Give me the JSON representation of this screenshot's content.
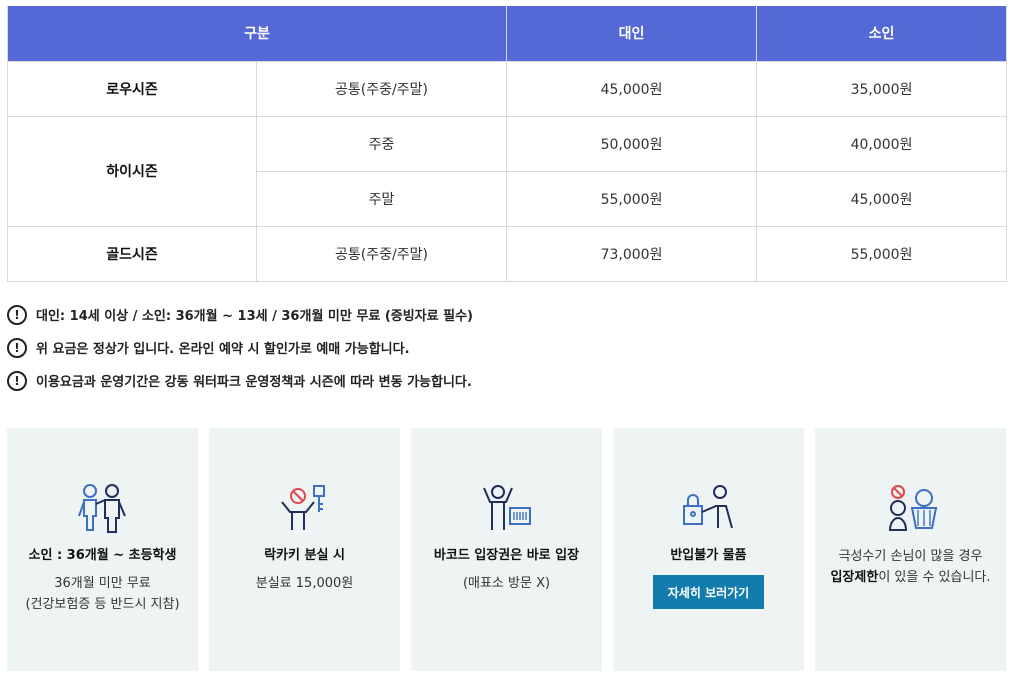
{
  "table": {
    "headers": {
      "category": "구분",
      "adult": "대인",
      "child": "소인"
    },
    "rows": [
      {
        "season": "로우시즌",
        "day": "공통(주중/주말)",
        "adult": "45,000원",
        "child": "35,000원"
      },
      {
        "season": "하이시즌",
        "day": "주중",
        "adult": "50,000원",
        "child": "40,000원"
      },
      {
        "day": "주말",
        "adult": "55,000원",
        "child": "45,000원"
      },
      {
        "season": "골드시즌",
        "day": "공통(주중/주말)",
        "adult": "73,000원",
        "child": "55,000원"
      }
    ]
  },
  "notices": [
    "대인: 14세 이상 / 소인: 36개월 ~ 13세 / 36개월 미만 무료 (증빙자료 필수)",
    "위 요금은 정상가 입니다. 온라인 예약 시 할인가로 예매 가능합니다.",
    "이용요금과 운영기간은 강동 워터파크 운영정책과 시즌에 따라 변동 가능합니다."
  ],
  "notice_icon": "!",
  "cards": [
    {
      "icon": "child-icon",
      "title": "소인 : 36개월 ~ 초등학생",
      "desc1": "36개월 미만 무료",
      "desc2": "(건강보험증 등 반드시 지참)"
    },
    {
      "icon": "lost-key-icon",
      "title": "락카키 분실 시",
      "desc1": "분실료 15,000원"
    },
    {
      "icon": "barcode-entry-icon",
      "title": "바코드 입장권은 바로 입장",
      "desc1": "(매표소 방문 X)"
    },
    {
      "icon": "prohibited-items-icon",
      "title": "반입불가 물품",
      "button": "자세히 보러가기"
    },
    {
      "icon": "crowd-limit-icon",
      "desc1": "극성수기 손님이 많을 경우",
      "desc2_bold": "입장제한",
      "desc2_rest": "이 있을 수 있습니다."
    }
  ],
  "colors": {
    "header_bg": "#5469d6",
    "card_bg": "#eef4f4",
    "button_bg": "#127cad",
    "icon_blue": "#3d6fc4",
    "icon_red": "#e0494b"
  }
}
